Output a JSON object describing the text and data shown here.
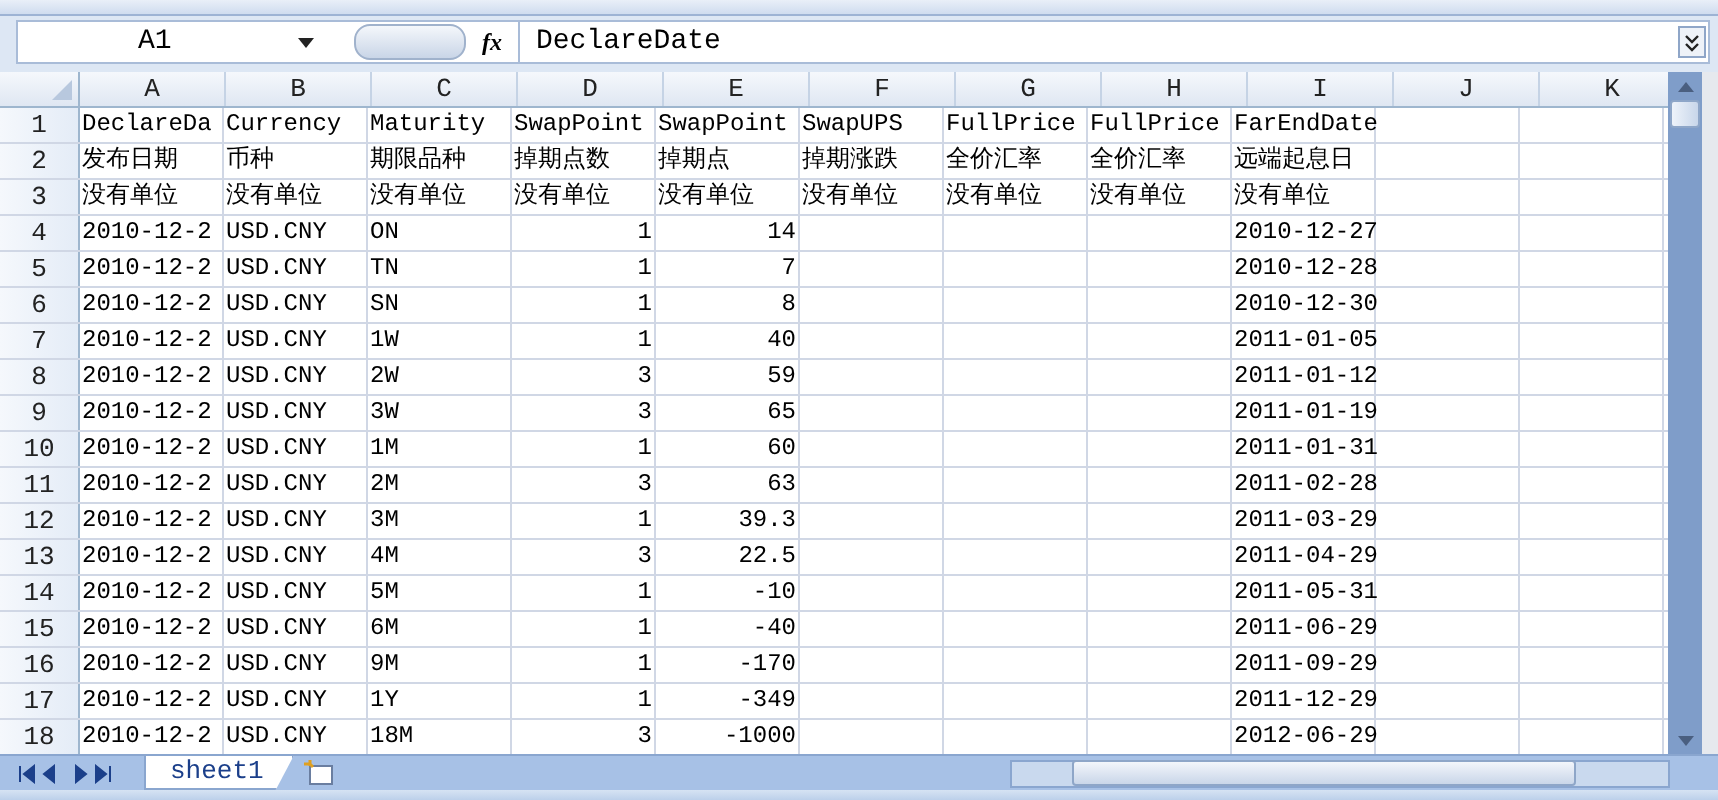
{
  "formula_bar": {
    "name_box": "A1",
    "function_label": "fx",
    "formula": "DeclareDate"
  },
  "columns": [
    "A",
    "B",
    "C",
    "D",
    "E",
    "F",
    "G",
    "H",
    "I",
    "J",
    "K"
  ],
  "rows": [
    {
      "number": "1",
      "kind": "header",
      "cells": [
        "DeclareDa",
        "Currency",
        "Maturity",
        "SwapPoint",
        "SwapPoint",
        "SwapUPS",
        "FullPrice",
        "FullPrice",
        "FarEndDate"
      ]
    },
    {
      "number": "2",
      "kind": "header",
      "cells": [
        "发布日期",
        "币种",
        "期限品种",
        "掉期点数",
        "掉期点",
        "掉期涨跌",
        "全价汇率",
        "全价汇率",
        "远端起息日"
      ]
    },
    {
      "number": "3",
      "kind": "header",
      "cells": [
        "没有单位",
        "没有单位",
        "没有单位",
        "没有单位",
        "没有单位",
        "没有单位",
        "没有单位",
        "没有单位",
        "没有单位"
      ]
    },
    {
      "number": "4",
      "kind": "data",
      "cells": [
        "2010-12-2",
        "USD.CNY",
        "ON",
        "1",
        "14",
        null,
        null,
        null,
        "2010-12-27"
      ]
    },
    {
      "number": "5",
      "kind": "data",
      "cells": [
        "2010-12-2",
        "USD.CNY",
        "TN",
        "1",
        "7",
        null,
        null,
        null,
        "2010-12-28"
      ]
    },
    {
      "number": "6",
      "kind": "data",
      "cells": [
        "2010-12-2",
        "USD.CNY",
        "SN",
        "1",
        "8",
        null,
        null,
        null,
        "2010-12-30"
      ]
    },
    {
      "number": "7",
      "kind": "data",
      "cells": [
        "2010-12-2",
        "USD.CNY",
        "1W",
        "1",
        "40",
        null,
        null,
        null,
        "2011-01-05"
      ]
    },
    {
      "number": "8",
      "kind": "data",
      "cells": [
        "2010-12-2",
        "USD.CNY",
        "2W",
        "3",
        "59",
        null,
        null,
        null,
        "2011-01-12"
      ]
    },
    {
      "number": "9",
      "kind": "data",
      "cells": [
        "2010-12-2",
        "USD.CNY",
        "3W",
        "3",
        "65",
        null,
        null,
        null,
        "2011-01-19"
      ]
    },
    {
      "number": "10",
      "kind": "data",
      "cells": [
        "2010-12-2",
        "USD.CNY",
        "1M",
        "1",
        "60",
        null,
        null,
        null,
        "2011-01-31"
      ]
    },
    {
      "number": "11",
      "kind": "data",
      "cells": [
        "2010-12-2",
        "USD.CNY",
        "2M",
        "3",
        "63",
        null,
        null,
        null,
        "2011-02-28"
      ]
    },
    {
      "number": "12",
      "kind": "data",
      "cells": [
        "2010-12-2",
        "USD.CNY",
        "3M",
        "1",
        "39.3",
        null,
        null,
        null,
        "2011-03-29"
      ]
    },
    {
      "number": "13",
      "kind": "data",
      "cells": [
        "2010-12-2",
        "USD.CNY",
        "4M",
        "3",
        "22.5",
        null,
        null,
        null,
        "2011-04-29"
      ]
    },
    {
      "number": "14",
      "kind": "data",
      "cells": [
        "2010-12-2",
        "USD.CNY",
        "5M",
        "1",
        "-10",
        null,
        null,
        null,
        "2011-05-31"
      ]
    },
    {
      "number": "15",
      "kind": "data",
      "cells": [
        "2010-12-2",
        "USD.CNY",
        "6M",
        "1",
        "-40",
        null,
        null,
        null,
        "2011-06-29"
      ]
    },
    {
      "number": "16",
      "kind": "data",
      "cells": [
        "2010-12-2",
        "USD.CNY",
        "9M",
        "1",
        "-170",
        null,
        null,
        null,
        "2011-09-29"
      ]
    },
    {
      "number": "17",
      "kind": "data",
      "cells": [
        "2010-12-2",
        "USD.CNY",
        "1Y",
        "1",
        "-349",
        null,
        null,
        null,
        "2011-12-29"
      ]
    },
    {
      "number": "18",
      "kind": "data",
      "cells": [
        "2010-12-2",
        "USD.CNY",
        "18M",
        "3",
        "-1000",
        null,
        null,
        null,
        "2012-06-29"
      ]
    }
  ],
  "sheet_tabs": [
    {
      "label": "sheet1",
      "selected": true
    }
  ]
}
